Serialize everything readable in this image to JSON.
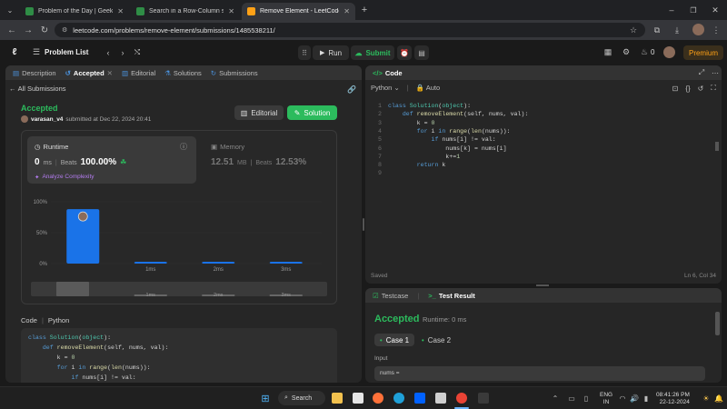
{
  "browser": {
    "tabs": [
      {
        "title": "Problem of the Day | GeeksforG",
        "icon": "gfg-icon",
        "color": "#2f8d46",
        "active": false
      },
      {
        "title": "Search in a Row-Column sorted",
        "icon": "gfg-icon",
        "color": "#2f8d46",
        "active": false
      },
      {
        "title": "Remove Element - LeetCode",
        "icon": "leetcode-icon",
        "color": "#ffa116",
        "active": true
      }
    ],
    "url": "leetcode.com/problems/remove-element/submissions/1485538211/"
  },
  "lc_nav": {
    "problem_list": "Problem List",
    "run": "Run",
    "submit": "Submit",
    "streak": "0",
    "premium": "Premium"
  },
  "left_panel": {
    "tabs": [
      {
        "label": "Description",
        "icon": "description-icon"
      },
      {
        "label": "Accepted",
        "icon": "accepted-icon",
        "active": true
      },
      {
        "label": "Editorial",
        "icon": "editorial-icon"
      },
      {
        "label": "Solutions",
        "icon": "solutions-icon"
      },
      {
        "label": "Submissions",
        "icon": "submissions-icon"
      }
    ],
    "back_label": "All Submissions",
    "status": "Accepted",
    "user": "varasan_v4",
    "submitted": "submitted at Dec 22, 2024 20:41",
    "editorial_btn": "Editorial",
    "solution_btn": "Solution",
    "runtime": {
      "title": "Runtime",
      "value": "0",
      "unit": "ms",
      "beats_label": "Beats",
      "beats_value": "100.00%",
      "analyze": "Analyze Complexity"
    },
    "memory": {
      "title": "Memory",
      "value": "12.51",
      "unit": "MB",
      "beats_label": "Beats",
      "beats_value": "12.53%"
    },
    "code_header": {
      "code": "Code",
      "lang": "Python"
    },
    "code_lines": [
      "class Solution(object):",
      "    def removeElement(self, nums, val):",
      "        k = 0",
      "        for i in range(len(nums)):",
      "            if nums[i] != val:"
    ]
  },
  "chart_data": {
    "type": "bar",
    "categories": [
      "0ms",
      "1ms",
      "2ms",
      "3ms"
    ],
    "values": [
      88,
      3,
      3,
      3
    ],
    "ylim": [
      0,
      100
    ],
    "ytick_labels": [
      "100%",
      "50%",
      "0%"
    ],
    "xtick_labels": [
      "",
      "1ms",
      "2ms",
      "3ms"
    ],
    "navigator_labels": [
      "1ms",
      "2ms",
      "3ms"
    ],
    "highlight_color": "#1a73e8"
  },
  "editor": {
    "title": "Code",
    "lang": "Python",
    "mode": "Auto",
    "lines": [
      "class Solution(object):",
      "    def removeElement(self, nums, val):",
      "        k = 0",
      "        for i in range(len(nums)):",
      "            if nums[i] != val:",
      "                nums[k] = nums[i]",
      "                k+=1",
      "        return k",
      ""
    ],
    "line_numbers": [
      "1",
      "2",
      "3",
      "4",
      "5",
      "6",
      "7",
      "8",
      "9"
    ],
    "saved": "Saved",
    "cursor": "Ln 6, Col 34"
  },
  "result_panel": {
    "tabs": [
      {
        "label": "Testcase",
        "icon": "testcase-icon"
      },
      {
        "label": "Test Result",
        "icon": "test-result-icon",
        "active": true
      }
    ],
    "status": "Accepted",
    "runtime": "Runtime: 0 ms",
    "cases": [
      "Case 1",
      "Case 2"
    ],
    "input_label": "Input",
    "input_value": "nums ="
  },
  "taskbar": {
    "search": "Search",
    "lang1": "ENG",
    "lang2": "IN",
    "time": "08:41:26 PM",
    "date": "22-12-2024"
  }
}
